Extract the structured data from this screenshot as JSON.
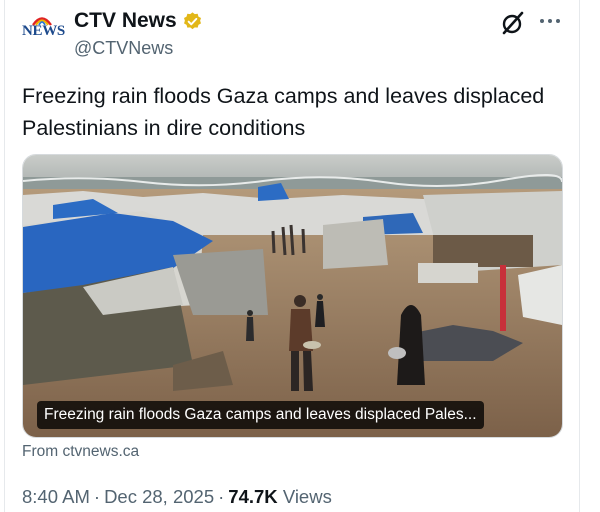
{
  "author": {
    "avatar_logo_text": "NEWS",
    "display_name": "CTV News",
    "handle": "@CTVNews"
  },
  "tweet": {
    "text": "Freezing rain floods Gaza camps and leaves displaced Palestinians in dire conditions"
  },
  "link_card": {
    "caption": "Freezing rain floods Gaza camps and leaves displaced Pales...",
    "source": "From ctvnews.ca"
  },
  "meta": {
    "time": "8:40 AM",
    "date": "Dec 28, 2025",
    "separator": "·",
    "views_count": "74.7K",
    "views_label": "Views"
  },
  "icons": {
    "verified": "verified-badge-icon",
    "grok": "grok-icon",
    "more": "more-options-icon"
  },
  "colors": {
    "verified_gold": "#e2b719",
    "secondary_text": "#536471",
    "primary_text": "#0f1419"
  }
}
